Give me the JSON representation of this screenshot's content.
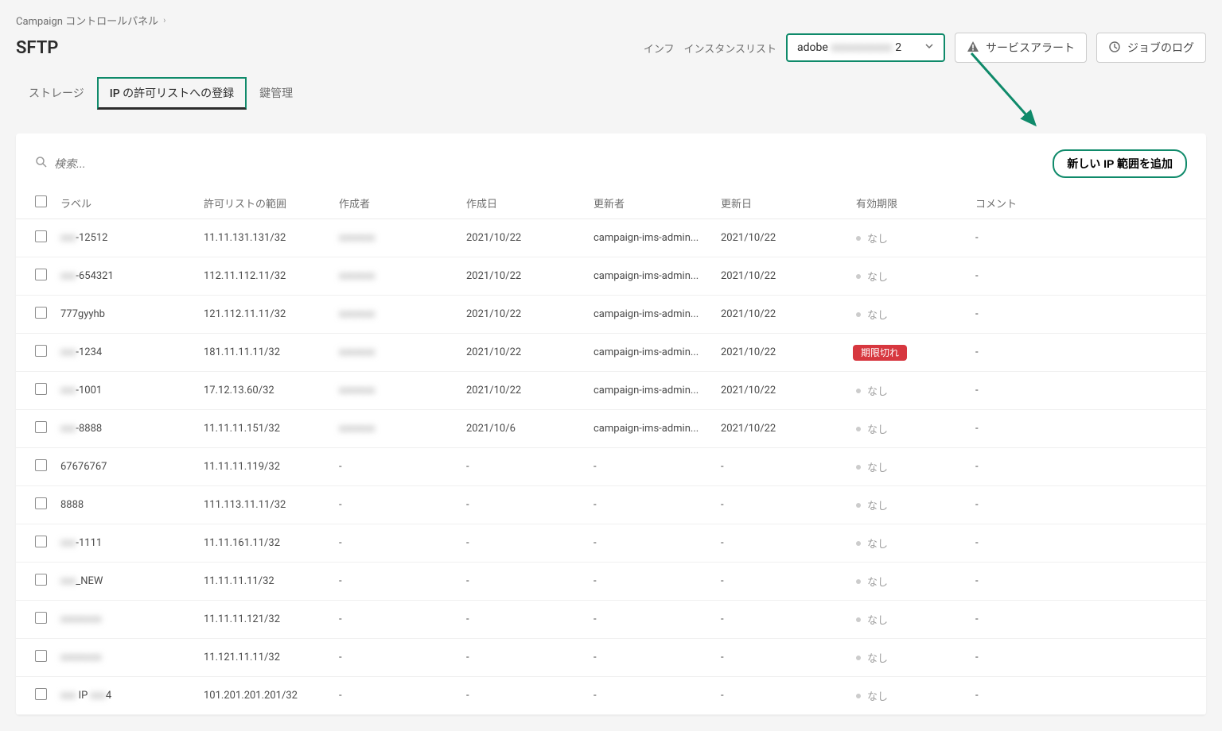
{
  "breadcrumb": {
    "parent": "Campaign コントロールパネル"
  },
  "page_title": "SFTP",
  "header": {
    "instance_prefix": "インフ",
    "instance_list_label": "インスタンスリスト",
    "instance_value_pre": "adobe",
    "instance_value_post": "2",
    "service_alert": "サービスアラート",
    "job_log": "ジョブのログ"
  },
  "tabs": {
    "storage": "ストレージ",
    "ip_allow": "IP の許可リストへの登録",
    "key_mgmt": "鍵管理"
  },
  "search_placeholder": "検索...",
  "add_button": "新しい IP 範囲を追加",
  "columns": {
    "label": "ラベル",
    "range": "許可リストの範囲",
    "creator": "作成者",
    "created": "作成日",
    "updater": "更新者",
    "updated": "更新日",
    "expiry": "有効期限",
    "comment": "コメント"
  },
  "status_none": "なし",
  "status_expired": "期限切れ",
  "rows": [
    {
      "label_pre": "xxx",
      "label": "-12512",
      "range": "11.11.131.131/32",
      "creator": "blur",
      "created": "2021/10/22",
      "updater": "campaign-ims-admin...",
      "updated": "2021/10/22",
      "expiry": "none",
      "comment": "-"
    },
    {
      "label_pre": "xxx",
      "label": "-654321",
      "range": "112.11.112.11/32",
      "creator": "blur",
      "created": "2021/10/22",
      "updater": "campaign-ims-admin...",
      "updated": "2021/10/22",
      "expiry": "none",
      "comment": "-"
    },
    {
      "label_pre": "",
      "label": "777gyyhb",
      "range": "121.112.11.11/32",
      "creator": "blur",
      "created": "2021/10/22",
      "updater": "campaign-ims-admin...",
      "updated": "2021/10/22",
      "expiry": "none",
      "comment": "-"
    },
    {
      "label_pre": "xxx",
      "label": "-1234",
      "range": "181.11.11.11/32",
      "creator": "blur",
      "created": "2021/10/22",
      "updater": "campaign-ims-admin...",
      "updated": "2021/10/22",
      "expiry": "expired",
      "comment": "-"
    },
    {
      "label_pre": "xxx",
      "label": "-1001",
      "range": "17.12.13.60/32",
      "creator": "blur",
      "created": "2021/10/22",
      "updater": "campaign-ims-admin...",
      "updated": "2021/10/22",
      "expiry": "none",
      "comment": "-"
    },
    {
      "label_pre": "xxx",
      "label": "-8888",
      "range": "11.11.11.151/32",
      "creator": "blur",
      "created": "2021/10/6",
      "updater": "campaign-ims-admin...",
      "updated": "2021/10/22",
      "expiry": "none",
      "comment": "-"
    },
    {
      "label_pre": "",
      "label": "67676767",
      "range": "11.11.11.119/32",
      "creator": "-",
      "created": "-",
      "updater": "-",
      "updated": "-",
      "expiry": "none",
      "comment": "-"
    },
    {
      "label_pre": "",
      "label": "8888",
      "range": "111.113.11.11/32",
      "creator": "-",
      "created": "-",
      "updater": "-",
      "updated": "-",
      "expiry": "none",
      "comment": "-"
    },
    {
      "label_pre": "xxx",
      "label": "-1111",
      "range": "11.11.161.11/32",
      "creator": "-",
      "created": "-",
      "updater": "-",
      "updated": "-",
      "expiry": "none",
      "comment": "-"
    },
    {
      "label_pre": "xxx",
      "label": "_NEW",
      "range": "11.11.11.11/32",
      "creator": "-",
      "created": "-",
      "updater": "-",
      "updated": "-",
      "expiry": "none",
      "comment": "-"
    },
    {
      "label_pre": "xxxxxxxx",
      "label": "",
      "range": "11.11.11.121/32",
      "creator": "-",
      "created": "-",
      "updater": "-",
      "updated": "-",
      "expiry": "none",
      "comment": "-"
    },
    {
      "label_pre": "xxxxxxxx",
      "label": "",
      "range": "11.121.11.11/32",
      "creator": "-",
      "created": "-",
      "updater": "-",
      "updated": "-",
      "expiry": "none",
      "comment": "-"
    },
    {
      "label_pre": "xxx",
      "label": " IP xxx4",
      "iplabel": true,
      "range": "101.201.201.201/32",
      "creator": "-",
      "created": "-",
      "updater": "-",
      "updated": "-",
      "expiry": "none",
      "comment": "-"
    }
  ]
}
